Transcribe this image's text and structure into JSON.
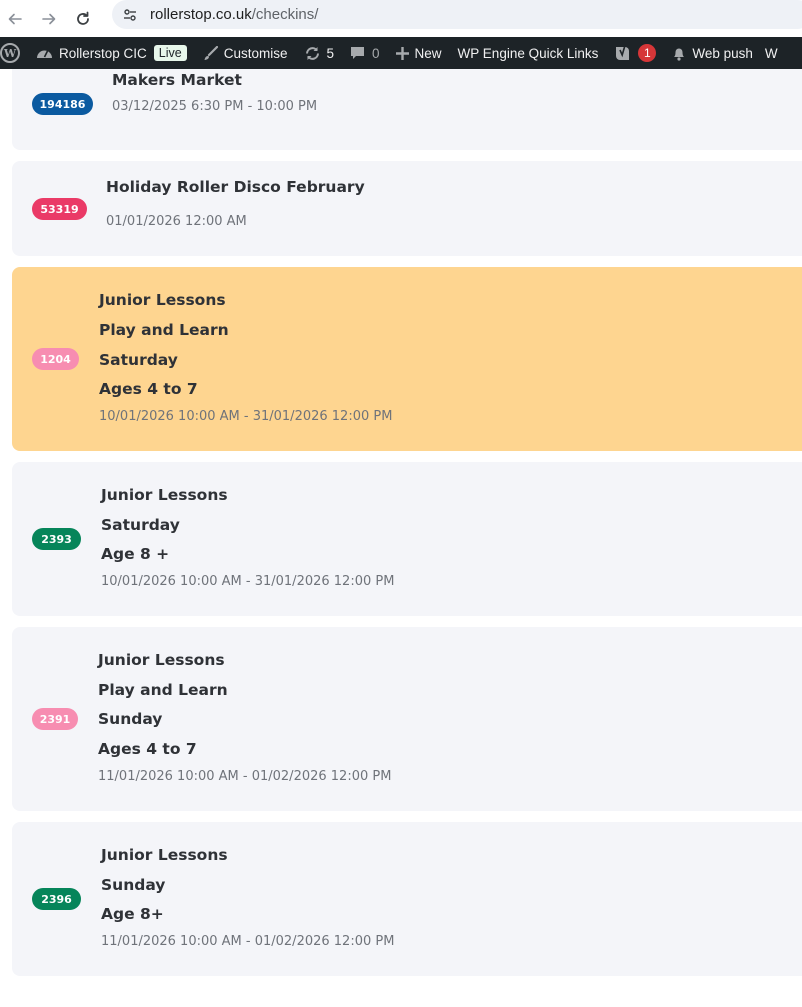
{
  "browser": {
    "url_domain": "rollerstop.co.uk",
    "url_path": "/checkins/"
  },
  "admin_bar": {
    "site_name": "Rollerstop CIC",
    "live_label": "Live",
    "customise_label": "Customise",
    "updates_count": "5",
    "comments_count": "0",
    "new_label": "New",
    "quick_links_label": "WP Engine Quick Links",
    "yoast_count": "1",
    "web_push_label": "Web push",
    "overflow_label": "W"
  },
  "events": [
    {
      "badge": "194186",
      "badge_color": "#0b5aa0",
      "title_lines": [
        "Makers Market"
      ],
      "date": "03/12/2025 6:30 PM - 10:00 PM",
      "highlighted": false
    },
    {
      "badge": "53319",
      "badge_color": "#ea3a67",
      "title_lines": [
        "Holiday Roller Disco February"
      ],
      "date": "01/01/2026 12:00 AM",
      "highlighted": false
    },
    {
      "badge": "1204",
      "badge_color": "#f78db1",
      "title_lines": [
        "Junior Lessons",
        "Play and Learn",
        "Saturday",
        "Ages 4 to 7"
      ],
      "date": "10/01/2026 10:00 AM - 31/01/2026 12:00 PM",
      "highlighted": true
    },
    {
      "badge": "2393",
      "badge_color": "#06855a",
      "title_lines": [
        "Junior Lessons",
        "Saturday",
        "Age 8 +"
      ],
      "date": "10/01/2026 10:00 AM - 31/01/2026 12:00 PM",
      "highlighted": false
    },
    {
      "badge": "2391",
      "badge_color": "#f78db1",
      "title_lines": [
        "Junior Lessons",
        "Play and Learn",
        "Sunday",
        "Ages 4 to 7"
      ],
      "date": "11/01/2026 10:00 AM - 01/02/2026 12:00 PM",
      "highlighted": false
    },
    {
      "badge": "2396",
      "badge_color": "#06855a",
      "title_lines": [
        "Junior Lessons",
        "Sunday",
        "Age 8+"
      ],
      "date": "11/01/2026 10:00 AM - 01/02/2026 12:00 PM",
      "highlighted": false
    }
  ]
}
